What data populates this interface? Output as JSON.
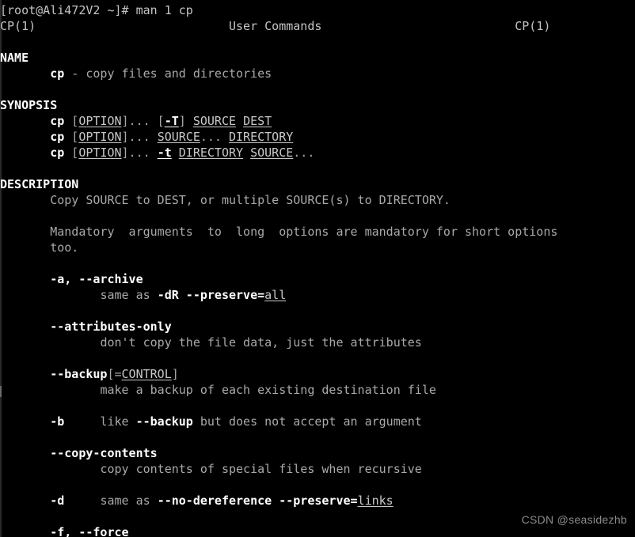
{
  "terminal": {
    "background_color": "#000000",
    "foreground_color": "#a9a9a9",
    "bold_color": "#ffffff",
    "columns": 80,
    "rows": 34
  },
  "prompt": {
    "text": "[root@Ali472V2 ~]# man 1 cp",
    "user": "root",
    "host": "Ali472V2",
    "cwd": "~",
    "symbol": "#",
    "command": "man 1 cp"
  },
  "man_header": {
    "left": "CP(1)",
    "center": "User Commands",
    "right": "CP(1)"
  },
  "sections": [
    {
      "heading": "NAME",
      "body": [
        "        cp - copy files and directories"
      ]
    },
    {
      "heading": "SYNOPSIS",
      "body": [
        "        cp [OPTION]... [-T] SOURCE DEST",
        "        cp [OPTION]... SOURCE... DIRECTORY",
        "        cp [OPTION]... -t DIRECTORY SOURCE..."
      ]
    },
    {
      "heading": "DESCRIPTION",
      "body": [
        "       Copy SOURCE to DEST, or multiple SOURCE(s) to DIRECTORY.",
        "       Mandatory  arguments  to  long  options are mandatory for short options",
        "       too."
      ]
    }
  ],
  "lines": {
    "l01": "[root@Ali472V2 ~]# man 1 cp",
    "l02_left": "CP(1)",
    "l02_center": "User Commands",
    "l02_right": "CP(1)",
    "l04": "NAME",
    "l05_indent": "       ",
    "l05_cp": "cp",
    "l05_rest": " - copy files and directories",
    "l07": "SYNOPSIS",
    "l08_indent": "       ",
    "l08_cp": "cp",
    "l08_sp1": " [",
    "l08_option": "OPTION",
    "l08_sp2": "]... [",
    "l08_T": "-T",
    "l08_sp3": "] ",
    "l08_source": "SOURCE",
    "l08_sp4": " ",
    "l08_dest": "DEST",
    "l09_indent": "       ",
    "l09_cp": "cp",
    "l09_sp1": " [",
    "l09_option": "OPTION",
    "l09_sp2": "]... ",
    "l09_source": "SOURCE",
    "l09_sp3": "... ",
    "l09_directory": "DIRECTORY",
    "l10_indent": "       ",
    "l10_cp": "cp",
    "l10_sp1": " [",
    "l10_option": "OPTION",
    "l10_sp2": "]... ",
    "l10_t": "-t",
    "l10_sp3": " ",
    "l10_directory": "DIRECTORY",
    "l10_sp4": " ",
    "l10_source": "SOURCE",
    "l10_sp5": "...",
    "l12": "DESCRIPTION",
    "l13": "       Copy SOURCE to DEST, or multiple SOURCE(s) to DIRECTORY.",
    "l15": "       Mandatory  arguments  to  long  options are mandatory for short options",
    "l16": "       too.",
    "l18_indent": "       ",
    "l18_opt": "-a, --archive",
    "l19_indent": "              ",
    "l19_text": "same as ",
    "l19_bold": "-dR --preserve=",
    "l19_under": "all",
    "l21_indent": "       ",
    "l21_opt": "--attributes-only",
    "l22_indent": "              ",
    "l22_text": "don't copy the file data, just the attributes",
    "l24_indent": "       ",
    "l24_bold1": "--backup",
    "l24_plain1": "[=",
    "l24_under": "CONTROL",
    "l24_plain2": "]",
    "l25_indent": "              ",
    "l25_text": "make a backup of each existing destination file",
    "l27_indent": "       ",
    "l27_opt": "-b",
    "l27_gap": "     ",
    "l27_text1": "like ",
    "l27_bold2": "--backup",
    "l27_text2": " but does not accept an argument",
    "l29_indent": "       ",
    "l29_opt": "--copy-contents",
    "l30_indent": "              ",
    "l30_text": "copy contents of special files when recursive",
    "l32_indent": "       ",
    "l32_opt": "-d",
    "l32_gap": "     ",
    "l32_text1": "same as ",
    "l32_bold": "--no-dereference --preserve=",
    "l32_under": "links",
    "l34_indent": "       ",
    "l34_opt": "-f, --force"
  },
  "watermark": {
    "text": "CSDN @seasidezhb"
  }
}
